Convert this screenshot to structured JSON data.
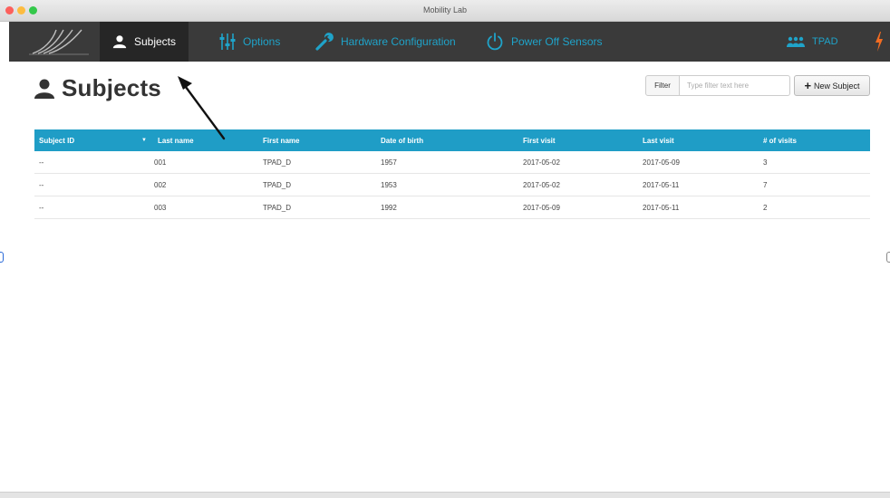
{
  "window": {
    "title": "Mobility Lab"
  },
  "navbar": {
    "items": [
      {
        "label": "Subjects",
        "icon": "user-icon",
        "active": true
      },
      {
        "label": "Options",
        "icon": "sliders-icon"
      },
      {
        "label": "Hardware Configuration",
        "icon": "wrench-icon"
      },
      {
        "label": "Power Off Sensors",
        "icon": "power-icon"
      }
    ],
    "user": {
      "label": "TPAD",
      "icon": "users-icon"
    },
    "bolt_icon": "bolt-icon",
    "logo_icon": "mobility-lab-logo-icon",
    "accent_color": "#1fa3c9",
    "bolt_color": "#f26c22",
    "bar_color": "#3a3a3a"
  },
  "page": {
    "title": "Subjects",
    "title_icon": "user-icon",
    "filter": {
      "label": "Filter",
      "placeholder": "Type filter text here",
      "value": ""
    },
    "new_button": {
      "label": "New Subject",
      "icon": "plus-icon"
    }
  },
  "table": {
    "header_color": "#1f9dc6",
    "sort_column": "Last name",
    "sort_direction": "descending",
    "columns": [
      "Subject ID",
      "Last name",
      "First name",
      "Date of birth",
      "First visit",
      "Last visit",
      "# of visits"
    ],
    "rows": [
      [
        "--",
        "001",
        "TPAD_D",
        "1957",
        "2017-05-02",
        "2017-05-09",
        "3"
      ],
      [
        "--",
        "002",
        "TPAD_D",
        "1953",
        "2017-05-02",
        "2017-05-11",
        "7"
      ],
      [
        "--",
        "003",
        "TPAD_D",
        "1992",
        "2017-05-09",
        "2017-05-11",
        "2"
      ]
    ]
  }
}
